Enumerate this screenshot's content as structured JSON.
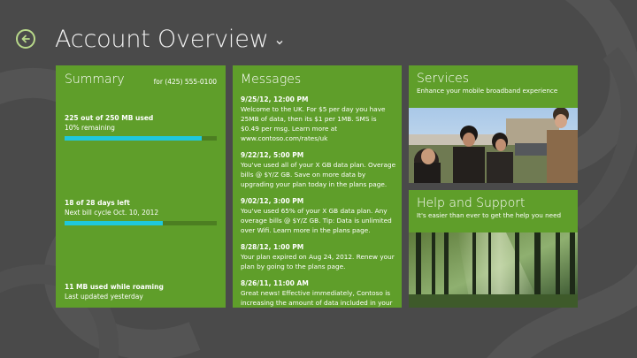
{
  "header": {
    "title": "Account Overview",
    "back_icon": "back-arrow-icon",
    "dropdown_icon": "chevron-down-icon"
  },
  "summary": {
    "title": "Summary",
    "phone": "for (425) 555-0100",
    "data_used": {
      "label": "225 out of 250 MB used",
      "sub": "10% remaining",
      "fraction": 0.9
    },
    "days": {
      "label": "18 of 28 days left",
      "sub": "Next bill cycle Oct. 10, 2012",
      "fraction": 0.643
    },
    "roaming": {
      "label": "11 MB used while roaming",
      "sub": "Last updated yesterday"
    }
  },
  "messages": {
    "title": "Messages",
    "items": [
      {
        "date": "9/25/12, 12:00 PM",
        "body": "Welcome to the UK. For $5 per day you have 25MB of data, then its $1 per 1MB. SMS is $0.49 per msg. Learn more at www.contoso.com/rates/uk"
      },
      {
        "date": "9/22/12, 5:00 PM",
        "body": "You've used all of your X GB data plan. Overage bills @ $Y/Z GB. Save on more data by upgrading your plan today in the plans page."
      },
      {
        "date": "9/02/12, 3:00 PM",
        "body": "You've used 65% of your X GB data plan. Any overage bills @ $Y/Z GB. Tip: Data is unlimited over Wifi. Learn more in the plans page."
      },
      {
        "date": "8/28/12, 1:00 PM",
        "body": "Your plan expired on Aug 24, 2012. Renew your plan by going to the plans page."
      },
      {
        "date": "8/26/11, 11:00 AM",
        "body": "Great news! Effective immediately, Contoso is increasing the amount of data included in your"
      }
    ]
  },
  "services": {
    "title": "Services",
    "subtitle": "Enhance your mobile broadband experience"
  },
  "help": {
    "title": "Help and Support",
    "subtitle": "It's easier than ever to get the help you need"
  },
  "colors": {
    "background": "#4a4a4a",
    "tile": "#5f9e2a",
    "bar_fill": "#1fc8dc",
    "bar_track": "#4c7e21",
    "back_ring": "#b8d98a"
  }
}
